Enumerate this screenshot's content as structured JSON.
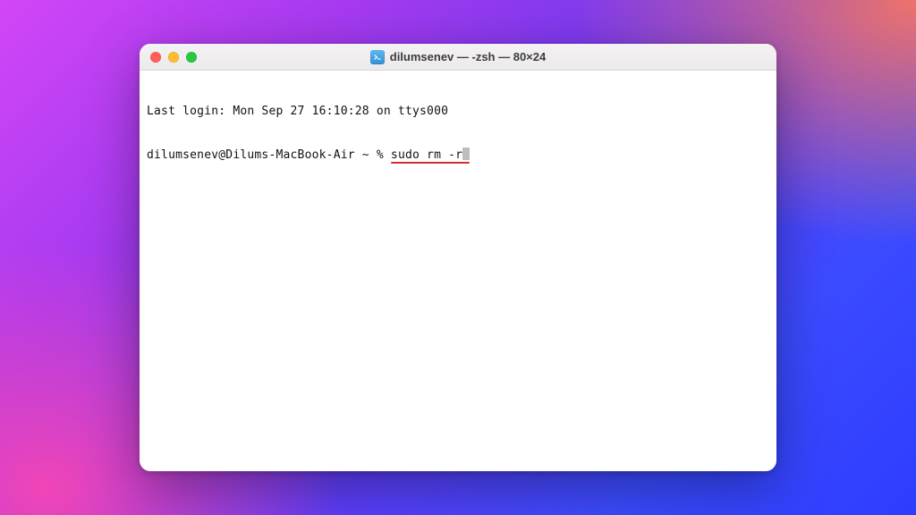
{
  "window": {
    "title_icon": "terminal-icon",
    "title": "dilumsenev — -zsh — 80×24",
    "traffic_lights": {
      "red": true,
      "yellow": true,
      "green": true
    }
  },
  "terminal": {
    "last_login_line": "Last login: Mon Sep 27 16:10:28 on ttys000",
    "prompt": "dilumsenev@Dilums-MacBook-Air ~ % ",
    "command": "sudo rm -r",
    "cursor_visible": true,
    "highlight_command": true
  }
}
